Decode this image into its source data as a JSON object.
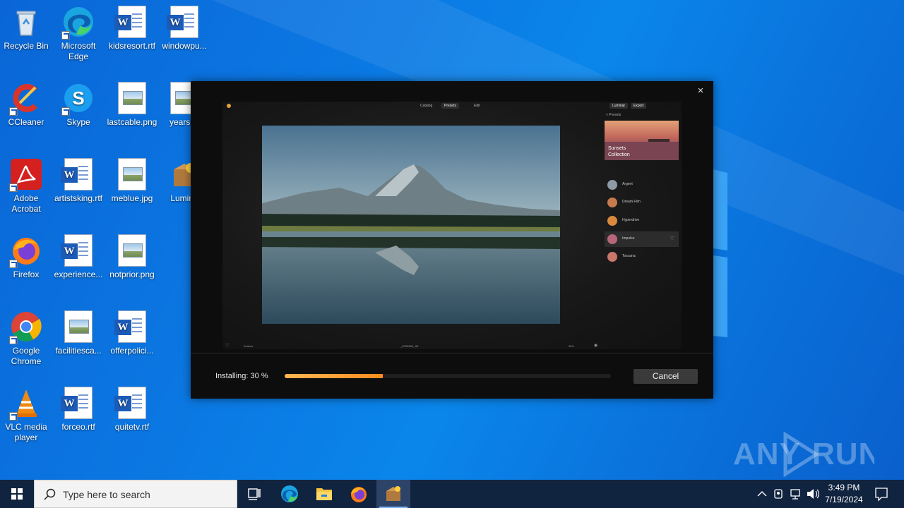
{
  "desktop": {
    "icons": [
      {
        "label": "Recycle Bin",
        "icon": "recycle-bin-icon"
      },
      {
        "label": "Microsoft Edge",
        "icon": "edge-icon"
      },
      {
        "label": "kidsresort.rtf",
        "icon": "word-doc-icon"
      },
      {
        "label": "windowpu...",
        "icon": "word-doc-icon"
      },
      {
        "label": "CCleaner",
        "icon": "ccleaner-icon"
      },
      {
        "label": "Skype",
        "icon": "skype-icon"
      },
      {
        "label": "lastcable.png",
        "icon": "image-file-icon"
      },
      {
        "label": "yearskb",
        "icon": "image-file-icon"
      },
      {
        "label": "Adobe Acrobat",
        "icon": "acrobat-icon"
      },
      {
        "label": "artistsking.rtf",
        "icon": "word-doc-icon"
      },
      {
        "label": "meblue.jpg",
        "icon": "image-file-icon"
      },
      {
        "label": "Lumina",
        "icon": "installer-icon"
      },
      {
        "label": "Firefox",
        "icon": "firefox-icon"
      },
      {
        "label": "experience...",
        "icon": "word-doc-icon"
      },
      {
        "label": "notprior.png",
        "icon": "image-file-icon"
      },
      {
        "label": "Google Chrome",
        "icon": "chrome-icon"
      },
      {
        "label": "facilitiesca...",
        "icon": "image-file-icon"
      },
      {
        "label": "offerpolici...",
        "icon": "word-doc-icon"
      },
      {
        "label": "VLC media player",
        "icon": "vlc-icon"
      },
      {
        "label": "forceo.rtf",
        "icon": "word-doc-icon"
      },
      {
        "label": "quitetv.rtf",
        "icon": "word-doc-icon"
      }
    ]
  },
  "installer": {
    "close_label": "×",
    "preview": {
      "tabs": [
        "Catalog",
        "Presets",
        "Edit"
      ],
      "top_right": [
        "Luminar",
        "Export"
      ],
      "back_label": "< Presets",
      "collection_title": "Sunsets\nCollection",
      "presets": [
        {
          "name": "Argent",
          "color": "#8e9aa6"
        },
        {
          "name": "Dream Film",
          "color": "#c67a4e"
        },
        {
          "name": "Hyperdrive",
          "color": "#d9883e"
        },
        {
          "name": "Impulse",
          "color": "#b6667a"
        },
        {
          "name": "Toscana",
          "color": "#c9776a"
        }
      ],
      "bottom_left": "Actions",
      "bottom_center": "_8753385_.tiff",
      "bottom_right": "30%"
    },
    "status_label": "Installing: 30 %",
    "progress": 0.3,
    "cancel_label": "Cancel",
    "accent": "#ff9a2e"
  },
  "watermark": "ANY RUN",
  "taskbar": {
    "search_placeholder": "Type here to search",
    "apps": [
      "task-view-icon",
      "edge-icon",
      "file-explorer-icon",
      "firefox-icon",
      "installer-icon"
    ],
    "time": "3:49 PM",
    "date": "7/19/2024"
  }
}
